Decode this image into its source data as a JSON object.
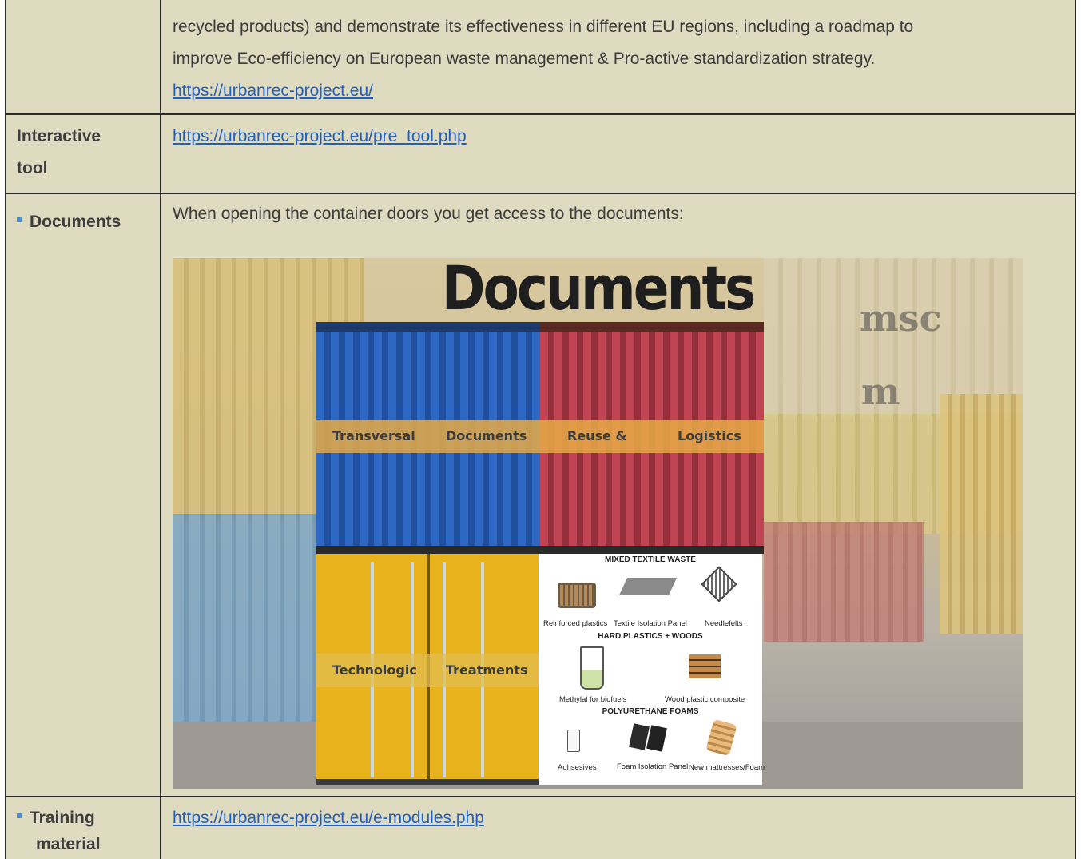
{
  "row1": {
    "line1": "recycled products) and demonstrate its effectiveness in different EU regions, including a roadmap to",
    "line2": "improve Eco-efficiency on European waste management & Pro-active standardization strategy.",
    "link": "https://urbanrec-project.eu/"
  },
  "row2": {
    "label_line1": "Interactive",
    "label_line2": "tool",
    "link": "https://urbanrec-project.eu/pre_tool.php"
  },
  "row3": {
    "label": "Documents",
    "intro": "When opening the container doors you get access to the documents:"
  },
  "image": {
    "title": "Documents",
    "logo_msc": "msc",
    "logo_m": "m",
    "blue": {
      "left": "Transversal",
      "right": "Documents"
    },
    "red": {
      "left": "Reuse &",
      "right": "Logistics"
    },
    "yellow": {
      "left": "Technologic",
      "right": "Treatments"
    },
    "panel": {
      "heading1": "MIXED TEXTILE WASTE",
      "items1": [
        "Reinforced plastics",
        "Textile Isolation Panel",
        "Needlefelts"
      ],
      "heading2": "HARD PLASTICS + WOODS",
      "items2": [
        "Methylal for biofuels",
        "Wood plastic composite"
      ],
      "heading3": "POLYURETHANE FOAMS",
      "items3": [
        "Adhsesives",
        "Foam Isolation Panel",
        "New mattresses/Foam"
      ]
    }
  },
  "row4": {
    "label_line1": "Training",
    "label_line2": "material",
    "link": "https://urbanrec-project.eu/e-modules.php"
  },
  "colors": {
    "cell_bg": "#dedbc1",
    "link": "#1f5fbf",
    "bullet": "#4f8fd6"
  }
}
